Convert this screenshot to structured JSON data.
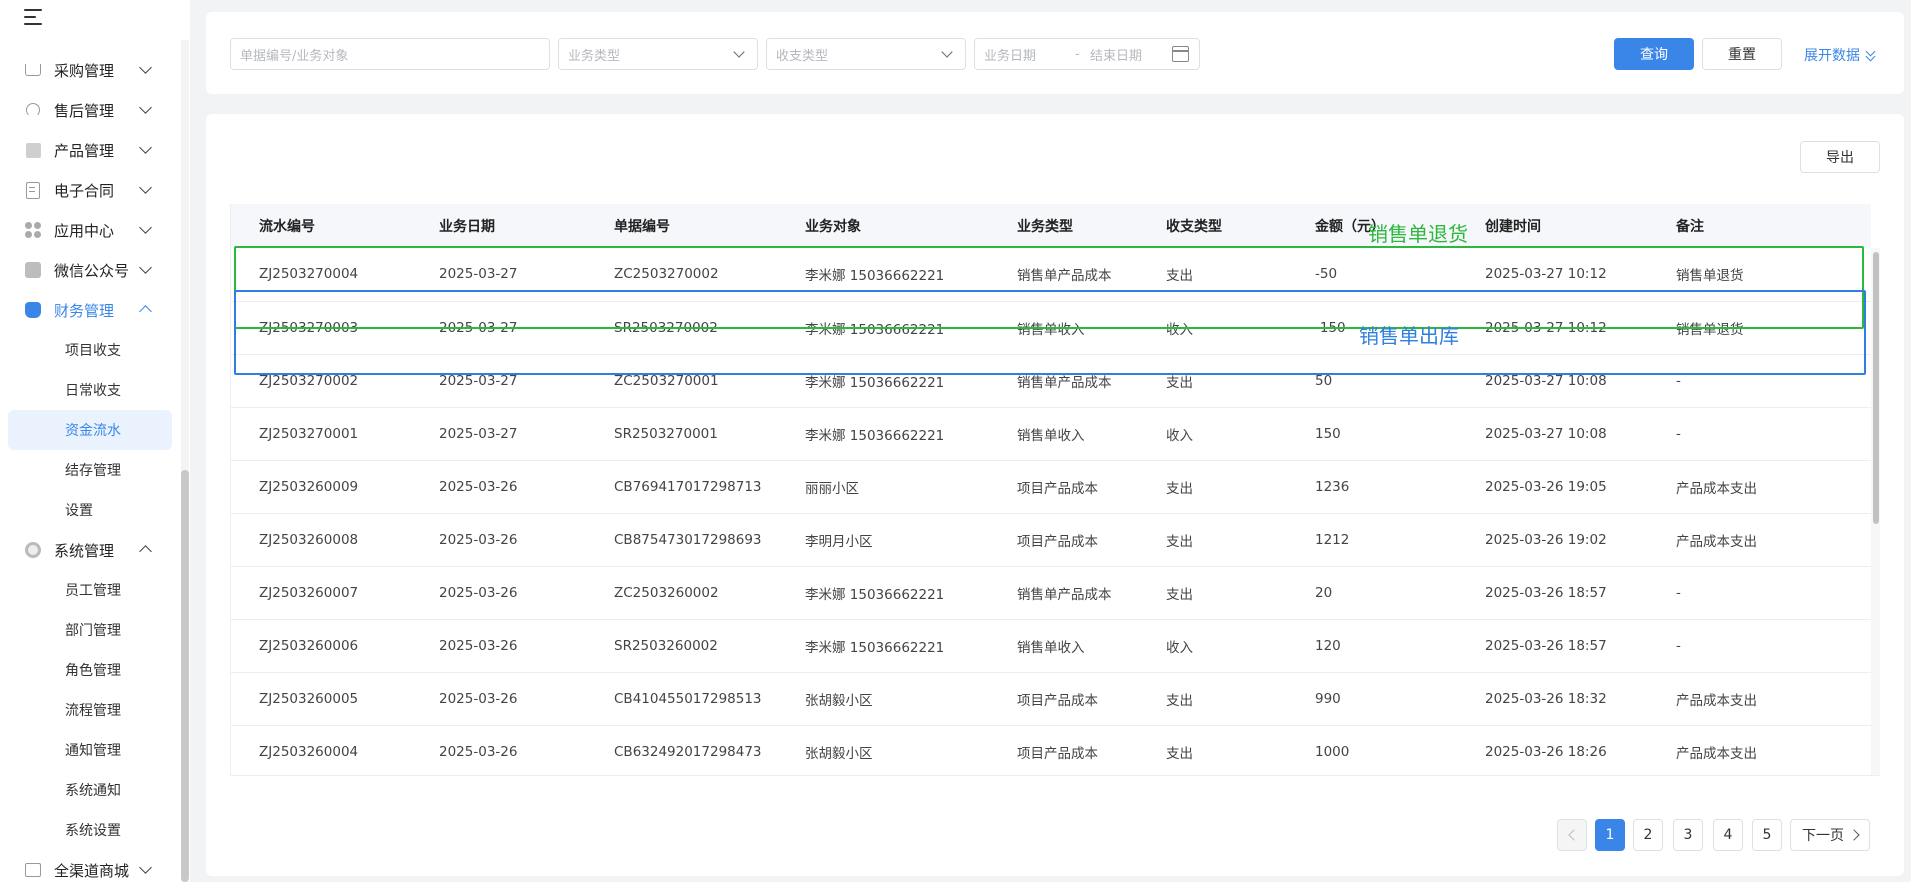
{
  "sidebar": {
    "menu": [
      {
        "label": "采购管理",
        "icon": "cart-icon"
      },
      {
        "label": "售后管理",
        "icon": "headset-icon"
      },
      {
        "label": "产品管理",
        "icon": "box-icon"
      },
      {
        "label": "电子合同",
        "icon": "contract-icon"
      },
      {
        "label": "应用中心",
        "icon": "apps-icon"
      },
      {
        "label": "微信公众号",
        "icon": "user-card-icon"
      },
      {
        "label": "财务管理",
        "icon": "money-bag-icon"
      },
      {
        "label": "系统管理",
        "icon": "gear-icon"
      },
      {
        "label": "全渠道商城",
        "icon": "mall-icon"
      }
    ],
    "finance_sub": [
      "项目收支",
      "日常收支",
      "资金流水",
      "结存管理",
      "设置"
    ],
    "system_sub": [
      "员工管理",
      "部门管理",
      "角色管理",
      "流程管理",
      "通知管理",
      "系统通知",
      "系统设置"
    ]
  },
  "filters": {
    "keyword_placeholder": "单据编号/业务对象",
    "biz_type_placeholder": "业务类型",
    "inout_type_placeholder": "收支类型",
    "start_date_placeholder": "业务日期",
    "date_sep": "-",
    "end_date_placeholder": "结束日期",
    "search_label": "查询",
    "reset_label": "重置",
    "expand_label": "展开数据"
  },
  "toolbar": {
    "export_label": "导出"
  },
  "table": {
    "headers": [
      "流水编号",
      "业务日期",
      "单据编号",
      "业务对象",
      "业务类型",
      "收支类型",
      "金额（元）",
      "创建时间",
      "备注"
    ],
    "rows": [
      [
        "ZJ2503270004",
        "2025-03-27",
        "ZC2503270002",
        "李米娜 15036662221",
        "销售单产品成本",
        "支出",
        "-50",
        "2025-03-27 10:12",
        "销售单退货"
      ],
      [
        "ZJ2503270003",
        "2025-03-27",
        "SR2503270002",
        "李米娜 15036662221",
        "销售单收入",
        "收入",
        "-150",
        "2025-03-27 10:12",
        "销售单退货"
      ],
      [
        "ZJ2503270002",
        "2025-03-27",
        "ZC2503270001",
        "李米娜 15036662221",
        "销售单产品成本",
        "支出",
        "50",
        "2025-03-27 10:08",
        "-"
      ],
      [
        "ZJ2503270001",
        "2025-03-27",
        "SR2503270001",
        "李米娜 15036662221",
        "销售单收入",
        "收入",
        "150",
        "2025-03-27 10:08",
        "-"
      ],
      [
        "ZJ2503260009",
        "2025-03-26",
        "CB769417017298713",
        "丽丽小区",
        "项目产品成本",
        "支出",
        "1236",
        "2025-03-26 19:05",
        "产品成本支出"
      ],
      [
        "ZJ2503260008",
        "2025-03-26",
        "CB875473017298693",
        "李明月小区",
        "项目产品成本",
        "支出",
        "1212",
        "2025-03-26 19:02",
        "产品成本支出"
      ],
      [
        "ZJ2503260007",
        "2025-03-26",
        "ZC2503260002",
        "李米娜 15036662221",
        "销售单产品成本",
        "支出",
        "20",
        "2025-03-26 18:57",
        "-"
      ],
      [
        "ZJ2503260006",
        "2025-03-26",
        "SR2503260002",
        "李米娜 15036662221",
        "销售单收入",
        "收入",
        "120",
        "2025-03-26 18:57",
        "-"
      ],
      [
        "ZJ2503260005",
        "2025-03-26",
        "CB410455017298513",
        "张胡毅小区",
        "项目产品成本",
        "支出",
        "990",
        "2025-03-26 18:32",
        "产品成本支出"
      ],
      [
        "ZJ2503260004",
        "2025-03-26",
        "CB632492017298473",
        "张胡毅小区",
        "项目产品成本",
        "支出",
        "1000",
        "2025-03-26 18:26",
        "产品成本支出"
      ]
    ]
  },
  "annotations": {
    "return_label": "销售单退货",
    "outbound_label": "销售单出库",
    "return_color": "#2db83d",
    "outbound_color": "#2f7fe0"
  },
  "pagination": {
    "pages": [
      "1",
      "2",
      "3",
      "4",
      "5"
    ],
    "current": "1",
    "next_label": "下一页"
  },
  "colors": {
    "accent": "#3a86e8"
  }
}
